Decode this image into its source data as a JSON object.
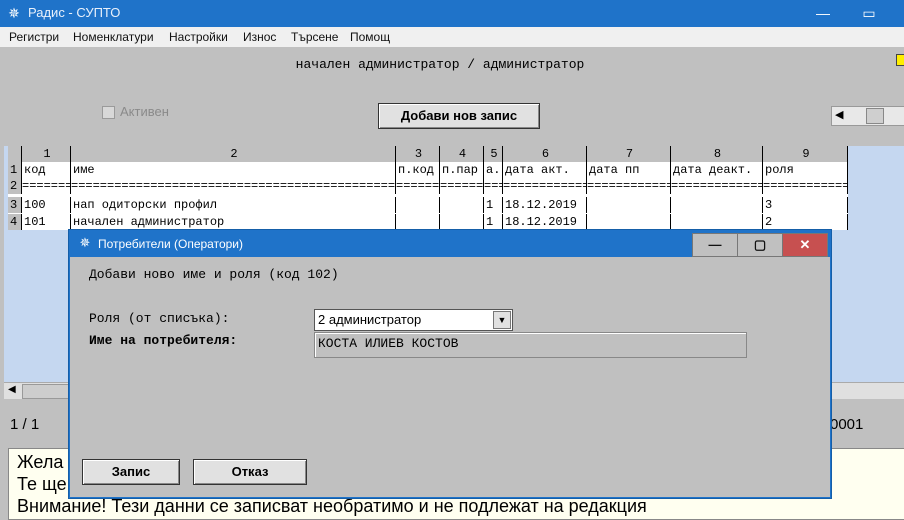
{
  "window": {
    "title": "Радис - СУПТО",
    "icon": "snowflake-icon",
    "controls": [
      "minimize",
      "maximize"
    ]
  },
  "menu": {
    "items": [
      {
        "label": "Регистри"
      },
      {
        "label": "Номенклатури"
      },
      {
        "label": "Настройки"
      },
      {
        "label": "Износ"
      },
      {
        "label": "Търсене"
      },
      {
        "label": "Помощ"
      }
    ]
  },
  "header": {
    "text": "начален администратор / администратор"
  },
  "toolbar": {
    "active_label": "Активен",
    "active_checked": false,
    "add_button": "Добави нов запис"
  },
  "grid": {
    "col_numbers": [
      "1",
      "2",
      "3",
      "4",
      "5",
      "6",
      "7",
      "8",
      "9"
    ],
    "col_names": [
      "код",
      "име",
      "п.код",
      "п.пар",
      "а.",
      "дата акт.",
      "дата пп",
      "дата деакт.",
      "роля"
    ],
    "row_numbers": [
      "1",
      "2",
      "3",
      "4"
    ],
    "separator": "=========================================================================================================",
    "rows": [
      [
        "100",
        "нап одиторски профил",
        "",
        "",
        "1",
        "18.12.2019",
        "",
        "",
        "3"
      ],
      [
        "101",
        "начален администратор",
        "",
        "",
        "1",
        "18.12.2019",
        "",
        "",
        "2"
      ]
    ]
  },
  "status": {
    "page": "1 / 1",
    "right_value": "0001"
  },
  "messages": {
    "line1": "Жела",
    "line2": "Те ще",
    "line3": "Внимание! Тези данни се записват необратимо и не подлежат на редакция"
  },
  "dialog": {
    "title": "Потребители (Оператори)",
    "icon": "snowflake-icon",
    "heading": "Добави ново име и роля (код 102)",
    "role_label": "Роля (от списъка):",
    "role_value": "2  администратор",
    "name_label": "Име на потребителя:",
    "name_value": "КОСТА ИЛИЕВ КОСТОВ",
    "save_button": "Запис",
    "cancel_button": "Отказ"
  }
}
